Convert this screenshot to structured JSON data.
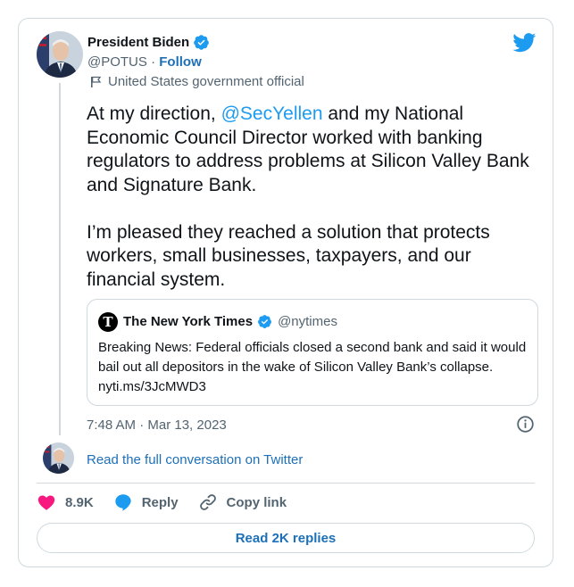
{
  "tweet": {
    "author": {
      "display_name": "President Biden",
      "handle": "@POTUS",
      "separator": " · ",
      "follow_label": "Follow",
      "affiliation_label": "United States government official"
    },
    "text_before_mention": "At my direction, ",
    "mention": "@SecYellen",
    "text_after_mention": " and my National Economic Council Director worked with banking regulators to address problems at Silicon Valley Bank and Signature Bank.\n\nI’m pleased they reached a solution that protects workers, small businesses, taxpayers, and our financial system.",
    "timestamp": "7:48 AM · Mar 13, 2023",
    "quoted": {
      "avatar_glyph": "T",
      "name": "The New York Times",
      "handle": "@nytimes",
      "text": "Breaking News: Federal officials closed a second bank and said it would bail out all depositors in the wake of Silicon Valley Bank’s collapse. nyti.ms/3JcMWD3"
    }
  },
  "conversation_link": "Read the full conversation on Twitter",
  "actions": {
    "like_count": "8.9K",
    "reply_label": "Reply",
    "copy_link_label": "Copy link"
  },
  "read_replies_label": "Read 2K replies",
  "icons": [
    "twitter-bird-icon",
    "verified-badge-icon",
    "flag-icon",
    "info-icon",
    "heart-icon",
    "reply-bubble-icon",
    "link-icon"
  ],
  "colors": {
    "brand_blue": "#1d9bf0",
    "link_blue": "#1d70b8",
    "heart": "#f91880",
    "border": "#cfd9de",
    "muted_text": "#536471"
  }
}
